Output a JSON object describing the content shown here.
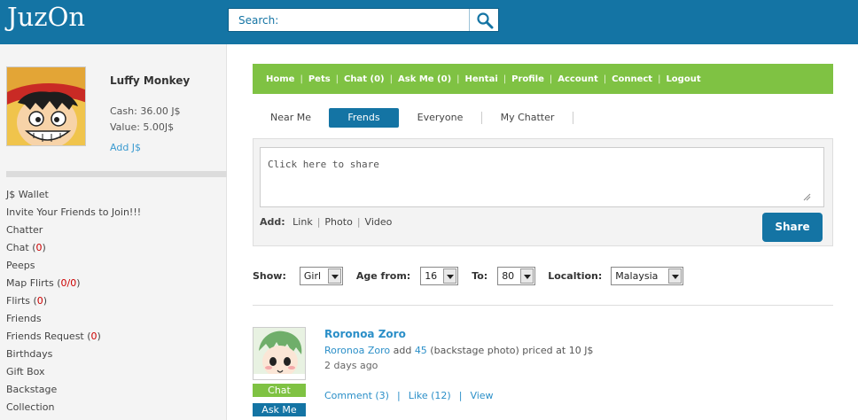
{
  "header": {
    "logo": "JuzOn",
    "search_label": "Search:"
  },
  "profile": {
    "name": "Luffy Monkey",
    "cash": "Cash: 36.00 J$",
    "value": "Value: 5.00J$",
    "add_js": "Add J$"
  },
  "sidebar": {
    "items": [
      {
        "label": "J$ Wallet",
        "count": ""
      },
      {
        "label": "Invite Your Friends to Join!!!",
        "count": ""
      },
      {
        "label": "Chatter",
        "count": ""
      },
      {
        "label": "Chat (",
        "count": "0",
        "suffix": ")"
      },
      {
        "label": "Peeps",
        "count": ""
      },
      {
        "label": "Map Flirts (",
        "count": "0/0",
        "suffix": ")"
      },
      {
        "label": "Flirts (",
        "count": "0",
        "suffix": ")"
      },
      {
        "label": "Friends",
        "count": ""
      },
      {
        "label": "Friends Request (",
        "count": "0",
        "suffix": ")"
      },
      {
        "label": "Birthdays",
        "count": ""
      },
      {
        "label": "Gift Box",
        "count": ""
      },
      {
        "label": "Backstage",
        "count": ""
      },
      {
        "label": "Collection",
        "count": ""
      }
    ]
  },
  "nav": {
    "items": [
      "Home",
      "Pets",
      "Chat (0)",
      "Ask Me (0)",
      "Hentai",
      "Profile",
      "Account",
      "Connect",
      "Logout"
    ]
  },
  "tabs": {
    "items": [
      "Near Me",
      "Frends",
      "Everyone",
      "My Chatter"
    ],
    "active": "Frends"
  },
  "share": {
    "placeholder": "Click here to share",
    "add_label": "Add:",
    "add_options": [
      "Link",
      "Photo",
      "Video"
    ],
    "button": "Share"
  },
  "filters": {
    "show_label": "Show:",
    "show_value": "Girl",
    "age_from_label": "Age from:",
    "age_from_value": "16",
    "to_label": "To:",
    "to_value": "80",
    "location_label": "Localtion:",
    "location_value": "Malaysia"
  },
  "feed": {
    "items": [
      {
        "name": "Roronoa Zoro",
        "actor": "Roronoa Zoro",
        "verb": " add ",
        "count": "45",
        "rest": " (backstage photo) priced at 10 J$",
        "time": "2 days ago",
        "comment": "Comment (3)",
        "like": "Like (12)",
        "view": "View",
        "chat_btn": "Chat",
        "askme_btn": "Ask Me"
      }
    ]
  },
  "colors": {
    "header_bg": "#1474a4",
    "nav_bg": "#7fc243",
    "link": "#2b8fc8",
    "count_red": "#cc0000"
  }
}
